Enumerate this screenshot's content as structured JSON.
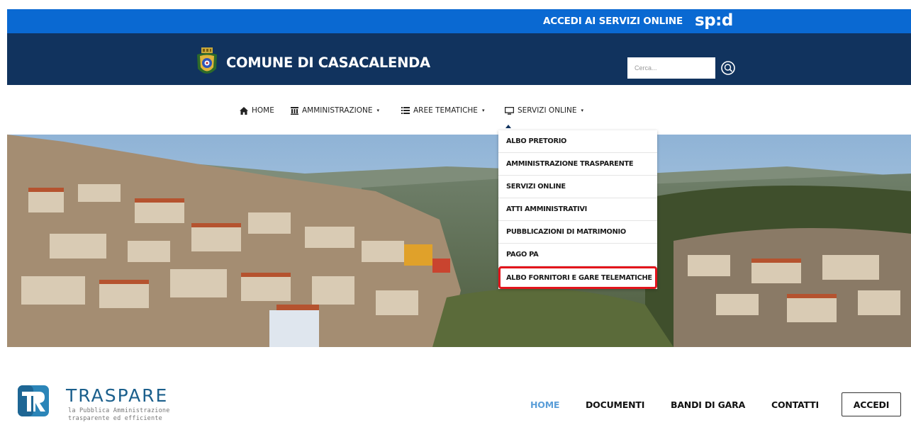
{
  "top_bar": {
    "spid_link_label": "ACCEDI AI SERVIZI ONLINE",
    "spid_logo_text": "sp:d",
    "background": "#0a69d2"
  },
  "header": {
    "site_title": "COMUNE DI CASACALENDA",
    "search_placeholder": "Cerca...",
    "background": "#11335e"
  },
  "main_nav": {
    "items": [
      {
        "label": "HOME",
        "icon": "home-icon"
      },
      {
        "label": "AMMINISTRAZIONE",
        "icon": "institution-icon",
        "caret": "▾"
      },
      {
        "label": "AREE TEMATICHE",
        "icon": "list-icon",
        "caret": "▾"
      },
      {
        "label": "SERVIZI ONLINE",
        "icon": "monitor-icon",
        "caret": "▾"
      }
    ]
  },
  "dropdown": {
    "items": [
      {
        "label": "ALBO PRETORIO"
      },
      {
        "label": "AMMINISTRAZIONE TRASPARENTE"
      },
      {
        "label": "SERVIZI ONLINE"
      },
      {
        "label": "ATTI AMMINISTRATIVI"
      },
      {
        "label": "PUBBLICAZIONI DI MATRIMONIO"
      },
      {
        "label": "PAGO PA"
      },
      {
        "label": "ALBO FORNITORI E GARE TELEMATICHE",
        "highlighted": true
      }
    ],
    "highlight_color": "#e3141c"
  },
  "traspare": {
    "brand": "TRASPARE",
    "tagline_line1": "la Pubblica Amministrazione",
    "tagline_line2": "trasparente ed efficiente",
    "nav": [
      {
        "label": "HOME",
        "active": true
      },
      {
        "label": "DOCUMENTI"
      },
      {
        "label": "BANDI DI GARA"
      },
      {
        "label": "CONTATTI"
      }
    ],
    "login_label": "ACCEDI",
    "active_color": "#5b9ed8"
  }
}
